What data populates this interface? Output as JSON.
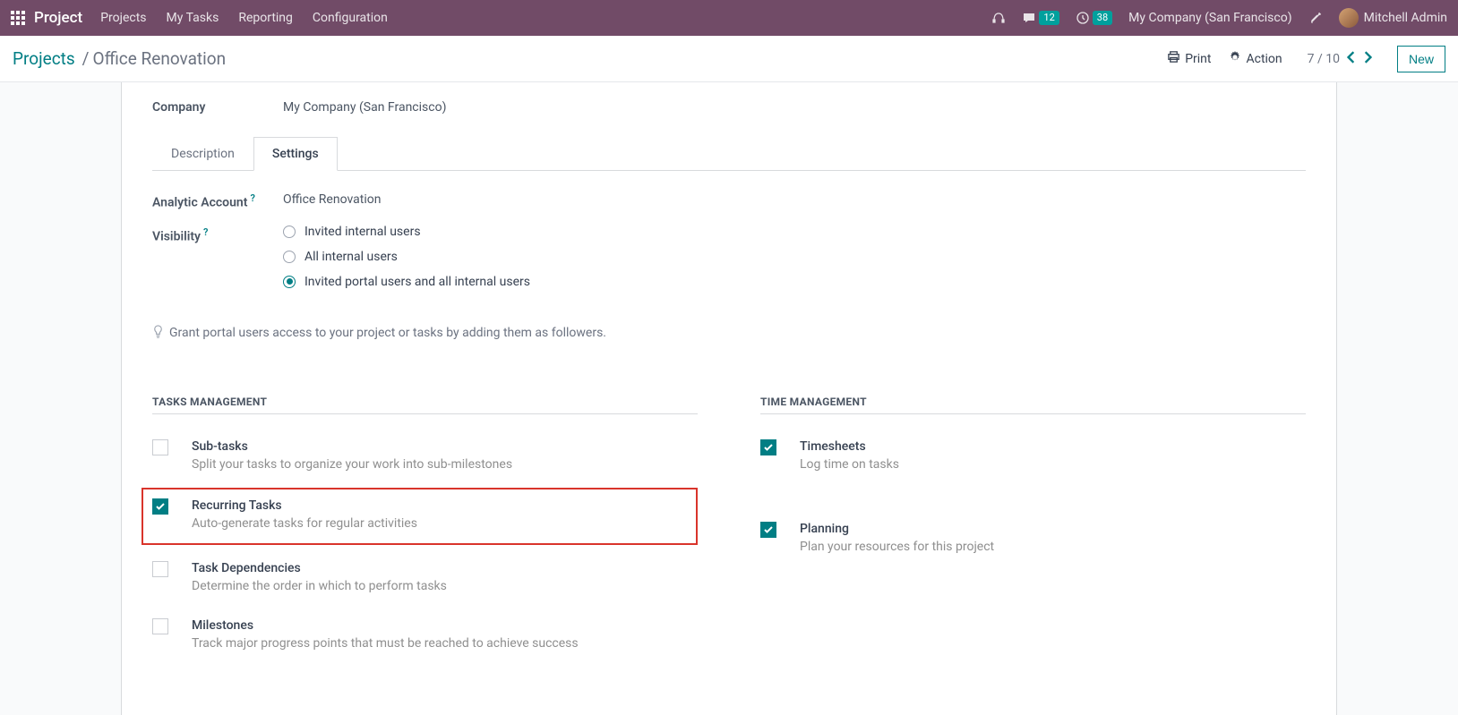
{
  "topbar": {
    "brand": "Project",
    "nav": [
      "Projects",
      "My Tasks",
      "Reporting",
      "Configuration"
    ],
    "messages_badge": "12",
    "activities_badge": "38",
    "company": "My Company (San Francisco)",
    "user": "Mitchell Admin"
  },
  "controlbar": {
    "breadcrumb_root": "Projects",
    "breadcrumb_current": "Office Renovation",
    "print": "Print",
    "action": "Action",
    "pager": "7 / 10",
    "new": "New"
  },
  "form": {
    "company_label": "Company",
    "company_value": "My Company (San Francisco)",
    "tabs": {
      "description": "Description",
      "settings": "Settings"
    },
    "analytic_label": "Analytic Account",
    "analytic_value": "Office Renovation",
    "visibility_label": "Visibility",
    "visibility_options": [
      "Invited internal users",
      "All internal users",
      "Invited portal users and all internal users"
    ],
    "visibility_tip": "Grant portal users access to your project or tasks by adding them as followers.",
    "section_tasks": "Tasks Management",
    "section_time": "Time Management",
    "tasks": {
      "subtasks": {
        "title": "Sub-tasks",
        "desc": "Split your tasks to organize your work into sub-milestones"
      },
      "recurring": {
        "title": "Recurring Tasks",
        "desc": "Auto-generate tasks for regular activities"
      },
      "dependencies": {
        "title": "Task Dependencies",
        "desc": "Determine the order in which to perform tasks"
      },
      "milestones": {
        "title": "Milestones",
        "desc": "Track major progress points that must be reached to achieve success"
      }
    },
    "time": {
      "timesheets": {
        "title": "Timesheets",
        "desc": "Log time on tasks"
      },
      "planning": {
        "title": "Planning",
        "desc": "Plan your resources for this project"
      }
    }
  }
}
